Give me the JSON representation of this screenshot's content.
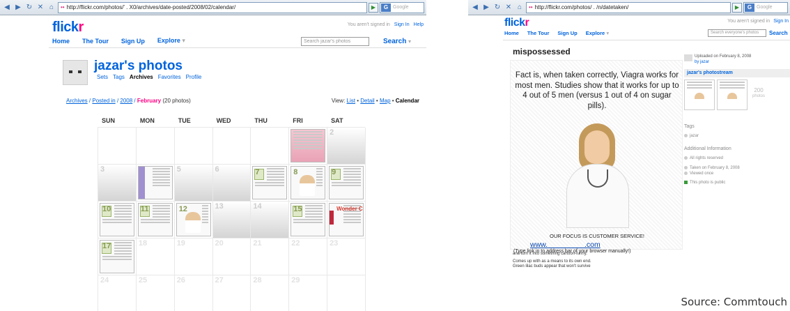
{
  "left": {
    "url": "http://flickr.com/photos/'   .   X0/archives/date-posted/2008/02/calendar/",
    "search_engine_placeholder": "Google",
    "logo_part1": "flick",
    "logo_part2": "r",
    "signed_status": "You aren't signed in",
    "sign_in": "Sign In",
    "help": "Help",
    "nav": [
      "Home",
      "The Tour",
      "Sign Up",
      "Explore"
    ],
    "search_placeholder": "Search jazar's photos",
    "search_button": "Search",
    "profile_title": "jazar's photos",
    "profile_tabs": [
      "Sets",
      "Tags",
      "Archives",
      "Favorites",
      "Profile"
    ],
    "crumb": {
      "archives": "Archives",
      "posted": "Posted in",
      "year": "2008",
      "month": "February",
      "count": "(20 photos)"
    },
    "view": {
      "label": "View:",
      "list": "List",
      "detail": "Detail",
      "map": "Map",
      "calendar": "Calendar"
    },
    "weekdays": [
      "SUN",
      "MON",
      "TUE",
      "WED",
      "THU",
      "FRI",
      "SAT"
    ],
    "weeks": [
      [
        {
          "d": "",
          "t": "out"
        },
        {
          "d": "",
          "t": "out"
        },
        {
          "d": "",
          "t": "out"
        },
        {
          "d": "",
          "t": "out"
        },
        {
          "d": "",
          "t": "out"
        },
        {
          "d": "1",
          "t": "photo",
          "v": "pink"
        },
        {
          "d": "2",
          "t": "in"
        }
      ],
      [
        {
          "d": "3",
          "t": "in"
        },
        {
          "d": "4",
          "t": "photo",
          "v": "purple"
        },
        {
          "d": "5",
          "t": "in"
        },
        {
          "d": "6",
          "t": "in"
        },
        {
          "d": "7",
          "t": "photo",
          "v": "doc"
        },
        {
          "d": "8",
          "t": "photo",
          "v": "nurse"
        },
        {
          "d": "9",
          "t": "photo",
          "v": "doc"
        }
      ],
      [
        {
          "d": "10",
          "t": "photo",
          "v": "doc"
        },
        {
          "d": "11",
          "t": "photo",
          "v": "doc"
        },
        {
          "d": "12",
          "t": "photo",
          "v": "nurse"
        },
        {
          "d": "13",
          "t": "in"
        },
        {
          "d": "14",
          "t": "in"
        },
        {
          "d": "15",
          "t": "photo",
          "v": "doc"
        },
        {
          "d": "16",
          "t": "photo",
          "v": "wonder"
        }
      ],
      [
        {
          "d": "17",
          "t": "photo",
          "v": "doc"
        },
        {
          "d": "18",
          "t": "out"
        },
        {
          "d": "19",
          "t": "out"
        },
        {
          "d": "20",
          "t": "out"
        },
        {
          "d": "21",
          "t": "out"
        },
        {
          "d": "22",
          "t": "out"
        },
        {
          "d": "23",
          "t": "out"
        }
      ],
      [
        {
          "d": "24",
          "t": "out"
        },
        {
          "d": "25",
          "t": "out"
        },
        {
          "d": "26",
          "t": "out"
        },
        {
          "d": "27",
          "t": "out"
        },
        {
          "d": "28",
          "t": "out"
        },
        {
          "d": "29",
          "t": "out"
        },
        {
          "d": "",
          "t": "out"
        }
      ]
    ],
    "wonder_text": "Wonder C"
  },
  "right": {
    "url": "http://flickr.com/photos/   .   /n/datetaken/",
    "search_engine_placeholder": "Google",
    "logo_part1": "flick",
    "logo_part2": "r",
    "signed_status": "You aren't signed in",
    "sign_in": "Sign In",
    "nav": [
      "Home",
      "The Tour",
      "Sign Up",
      "Explore"
    ],
    "search_placeholder": "Search everyone's photos",
    "search_button": "Search",
    "photo_title": "mispossessed",
    "spam_text": "Fact is, when taken correctly, Viagra works for most men. Studies show that it works for up to 4 out of 5 men (versus 1 out of 4 on sugar pills).",
    "focus_text": "OUR FOCUS IS CUSTOMER SERVICE!",
    "www_text": "www.        .com",
    "type_link_text": "(Type link in to address bar of your browser manually!)",
    "caption1": "and turn it into something cartoon-funny.",
    "caption2": "Comes up with as a means to its own end.",
    "caption3": "Green lilac buds appear that won't survive",
    "uploaded": "Uploaded on February 8, 2008",
    "uploaded_by": "by jazar",
    "photostream": "jazar's photostream",
    "count_num": "200",
    "count_label": "photos",
    "tags_label": "Tags",
    "tag": "jazar",
    "additional": "Additional Information",
    "rights": "All rights reserved",
    "taken": "Taken on February 8, 2008",
    "viewed": "Viewed once",
    "public": "This photo is public"
  },
  "source": "Source: Commtouch"
}
